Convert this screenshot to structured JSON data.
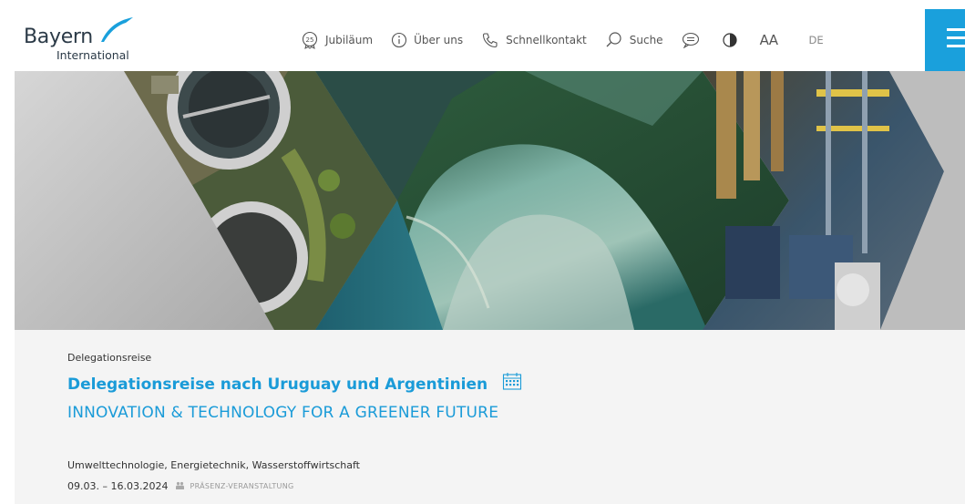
{
  "header": {
    "logo_main": "Bayern",
    "logo_sub": "International",
    "nav": {
      "jubilaeum": {
        "label": "Jubiläum",
        "badge": "25"
      },
      "about": {
        "label": "Über uns"
      },
      "contact": {
        "label": "Schnellkontakt"
      },
      "search": {
        "label": "Suche"
      }
    },
    "font_size_label": "AA",
    "language": "DE"
  },
  "hero": {
    "panels": [
      "wastewater-treatment",
      "river-landscape",
      "recycling-plant"
    ]
  },
  "event": {
    "kicker": "Delegationsreise",
    "title": "Delegationsreise nach Uruguay und Argentinien",
    "subtitle": "INNOVATION & TECHNOLOGY FOR A GREENER FUTURE",
    "topics": "Umwelttechnologie, Energietechnik, Wasserstoffwirtschaft",
    "date": "09.03. – 16.03.2024",
    "type": "PRÄSENZ-VERANSTALTUNG"
  },
  "colors": {
    "accent": "#1aa0dc",
    "text": "#333333",
    "panel_bg": "#f4f4f4"
  }
}
